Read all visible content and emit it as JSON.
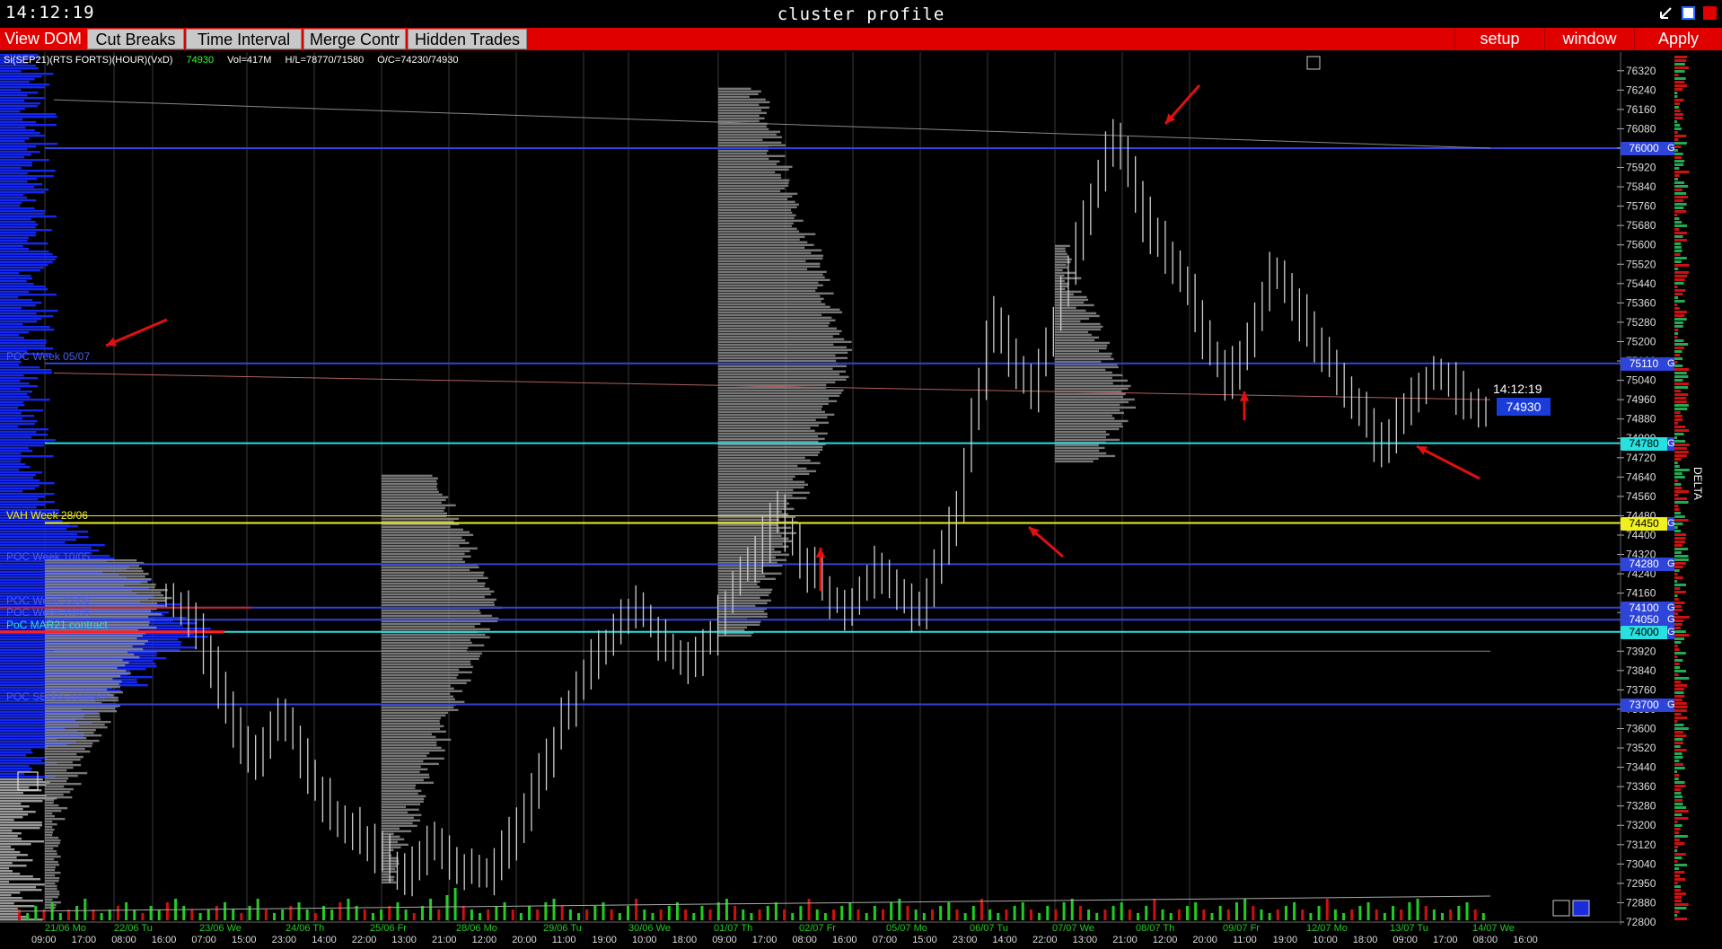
{
  "window": {
    "clock": "14:12:19",
    "title": "cluster profile"
  },
  "menu": {
    "view_dom": "View DOM",
    "cut_breaks": "Cut Breaks",
    "time_interval": "Time Interval",
    "merge_contr": "Merge Contr",
    "hidden_trades": "Hidden Trades",
    "setup": "setup",
    "window": "window",
    "apply": "Apply"
  },
  "info": {
    "symbol": "Si(SEP21)(RTS FORTS)(HOUR)(VxD)",
    "last": "74930",
    "vol": "Vol=417M",
    "hl": "H/L=78770/71580",
    "oc": "O/C=74230/74930"
  },
  "colors": {
    "menu_red": "#e00000",
    "level_blue": "#2f44d8",
    "level_cyan": "#28e0e0",
    "level_yellow": "#f0f020",
    "profile_blue": "#1428f0",
    "volume_green": "#22cc22",
    "volume_red": "#cc1111"
  },
  "level_labels": [
    {
      "text": "POC Week 05/07",
      "color": "#4a5cf0",
      "price": 75140
    },
    {
      "text": "VAH Week 28/06",
      "color": "#f0f020",
      "price": 74480
    },
    {
      "text": "POC Week 10/05",
      "color": "#4a5cf0",
      "price": 74310
    },
    {
      "text": "POC Week 21/06",
      "color": "#4a5cf0",
      "price": 74130
    },
    {
      "text": "POC Week 31/05",
      "color": "#4a5cf0",
      "price": 74080
    },
    {
      "text": "PoC MAR21 contract",
      "color": "#28e0e0",
      "price": 74030
    },
    {
      "text": "POC SEP21 contract",
      "color": "#4a5cf0",
      "price": 73730
    }
  ],
  "levels": [
    {
      "price": 76000,
      "label": "76000",
      "color": "#2f44d8",
      "text_color": "#fff"
    },
    {
      "price": 75110,
      "label": "75110",
      "color": "#2f44d8",
      "text_color": "#fff"
    },
    {
      "price": 74780,
      "label": "74780",
      "color": "#28e0e0",
      "text_color": "#000"
    },
    {
      "price": 74450,
      "label": "74450",
      "color": "#f0f020",
      "text_color": "#000"
    },
    {
      "price": 74280,
      "label": "74280",
      "color": "#2f44d8",
      "text_color": "#fff"
    },
    {
      "price": 74100,
      "label": "74100",
      "color": "#2f44d8",
      "text_color": "#fff"
    },
    {
      "price": 74050,
      "label": "74050",
      "color": "#2f44d8",
      "text_color": "#fff"
    },
    {
      "price": 74000,
      "label": "74000",
      "color": "#28e0e0",
      "text_color": "#000"
    },
    {
      "price": 73700,
      "label": "73700",
      "color": "#2f44d8",
      "text_color": "#fff"
    }
  ],
  "g_tag": "G",
  "current": {
    "time": "14:12:19",
    "price": "74930"
  },
  "delta_label": "DELTA",
  "chart_data": {
    "type": "candlestick",
    "title": "",
    "ylim": [
      72800,
      76360
    ],
    "y_ticks": [
      76320,
      76240,
      76160,
      76080,
      76000,
      75920,
      75840,
      75760,
      75680,
      75600,
      75520,
      75440,
      75360,
      75280,
      75200,
      75120,
      75040,
      74960,
      74880,
      74800,
      74720,
      74640,
      74560,
      74480,
      74400,
      74320,
      74240,
      74160,
      74080,
      74000,
      73920,
      73840,
      73760,
      73680,
      73600,
      73520,
      73440,
      73360,
      73280,
      73200,
      73120,
      73040,
      72960,
      72880,
      72800
    ],
    "y_tick_labels": [
      "76320",
      "76240",
      "76160",
      "76080",
      "76000",
      "75920",
      "75840",
      "75760",
      "75680",
      "75600",
      "75520",
      "75440",
      "75360",
      "75280",
      "75200",
      "75120",
      "75040",
      "74960",
      "74880",
      "74800",
      "74720",
      "74640",
      "74560",
      "74480",
      "74400",
      "74320",
      "74240",
      "74160",
      "74080",
      "74000",
      "73920",
      "73840",
      "73760",
      "73680",
      "73600",
      "73520",
      "73440",
      "73360",
      "73280",
      "73200",
      "73120",
      "73040",
      "72950",
      "72880",
      "72800"
    ],
    "x_dates": [
      "21/06 Mo",
      "22/06 Tu",
      "23/06 We",
      "24/06 Th",
      "25/06 Fr",
      "28/06 Mo",
      "29/06 Tu",
      "30/06 We",
      "01/07 Th",
      "02/07 Fr",
      "05/07 Mo",
      "06/07 Tu",
      "07/07 We",
      "08/07 Th",
      "09/07 Fr",
      "12/07 Mo",
      "13/07 Tu",
      "14/07 We"
    ],
    "x_times": [
      "09:00",
      "17:00",
      "08:00",
      "16:00",
      "07:00",
      "15:00",
      "23:00",
      "14:00",
      "22:00",
      "13:00",
      "21:00",
      "12:00",
      "20:00",
      "11:00",
      "19:00",
      "10:00",
      "18:00",
      "09:00",
      "17:00",
      "08:00",
      "16:00",
      "07:00",
      "15:00",
      "23:00",
      "14:00",
      "22:00",
      "13:00",
      "21:00",
      "12:00",
      "20:00",
      "11:00",
      "19:00",
      "10:00",
      "18:00",
      "09:00",
      "17:00",
      "08:00",
      "16:00"
    ],
    "closes": [
      74150,
      74120,
      74080,
      74050,
      73980,
      73900,
      73850,
      73780,
      73700,
      73620,
      73550,
      73500,
      73470,
      73520,
      73600,
      73680,
      73640,
      73560,
      73480,
      73400,
      73350,
      73300,
      73260,
      73220,
      73200,
      73180,
      73150,
      73120,
      73100,
      73080,
      73050,
      73020,
      73000,
      73040,
      73080,
      73120,
      73100,
      73080,
      73060,
      73040,
      73020,
      73000,
      72990,
      73010,
      73050,
      73100,
      73150,
      73200,
      73260,
      73320,
      73400,
      73480,
      73560,
      73640,
      73700,
      73760,
      73820,
      73880,
      73920,
      73960,
      74000,
      74040,
      74080,
      74100,
      74060,
      74020,
      73980,
      73940,
      73900,
      73880,
      73860,
      73900,
      73950,
      74000,
      74060,
      74120,
      74200,
      74260,
      74300,
      74340,
      74380,
      74450,
      74500,
      74420,
      74360,
      74300,
      74260,
      74220,
      74180,
      74140,
      74120,
      74100,
      74140,
      74180,
      74220,
      74260,
      74240,
      74200,
      74160,
      74120,
      74080,
      74100,
      74180,
      74260,
      74340,
      74420,
      74500,
      74700,
      74900,
      75050,
      75200,
      75300,
      75250,
      75150,
      75100,
      75050,
      75000,
      75100,
      75200,
      75300,
      75400,
      75500,
      75600,
      75700,
      75800,
      75900,
      76000,
      76050,
      76000,
      75900,
      75800,
      75700,
      75650,
      75600,
      75550,
      75500,
      75450,
      75400,
      75300,
      75200,
      75150,
      75100,
      75050,
      75100,
      75150,
      75200,
      75300,
      75400,
      75500,
      75480,
      75420,
      75360,
      75300,
      75250,
      75200,
      75150,
      75100,
      75050,
      75000,
      74950,
      74900,
      74850,
      74800,
      74780,
      74830,
      74880,
      74930,
      74980,
      75020,
      75050,
      75080,
      75060,
      75020,
      74980,
      74950,
      74930,
      74920,
      74930
    ],
    "volumes": [
      3,
      2,
      4,
      3,
      5,
      2,
      3,
      4,
      6,
      3,
      2,
      3,
      4,
      5,
      3,
      2,
      4,
      3,
      5,
      6,
      4,
      3,
      2,
      3,
      4,
      5,
      3,
      2,
      4,
      6,
      3,
      2,
      3,
      4,
      5,
      3,
      2,
      4,
      3,
      5,
      6,
      4,
      3,
      2,
      3,
      4,
      5,
      3,
      2,
      4,
      6,
      3,
      7,
      9,
      4,
      3,
      2,
      3,
      4,
      5,
      3,
      2,
      4,
      3,
      5,
      6,
      4,
      3,
      2,
      3,
      4,
      5,
      3,
      2,
      4,
      6,
      3,
      2,
      3,
      4,
      5,
      3,
      2,
      4,
      3,
      5,
      6,
      4,
      3,
      2,
      3,
      4,
      5,
      3,
      2,
      4,
      6,
      3,
      2,
      3,
      4,
      5,
      3,
      2,
      4,
      3,
      5,
      6,
      4,
      3,
      2,
      3,
      4,
      5,
      3,
      2,
      4,
      6,
      3,
      2,
      3,
      4,
      5,
      3,
      2,
      4,
      3,
      5,
      6,
      4,
      3,
      2,
      3,
      4,
      5,
      3,
      2,
      4,
      6,
      3,
      2,
      3,
      4,
      5,
      3,
      2,
      4,
      3,
      5,
      6,
      4,
      3,
      2,
      3,
      4,
      5,
      3,
      2,
      4,
      6,
      3,
      2,
      3,
      4,
      5,
      3,
      2,
      4,
      3,
      5,
      6,
      4,
      3,
      2,
      3,
      4,
      5,
      3,
      2
    ]
  }
}
